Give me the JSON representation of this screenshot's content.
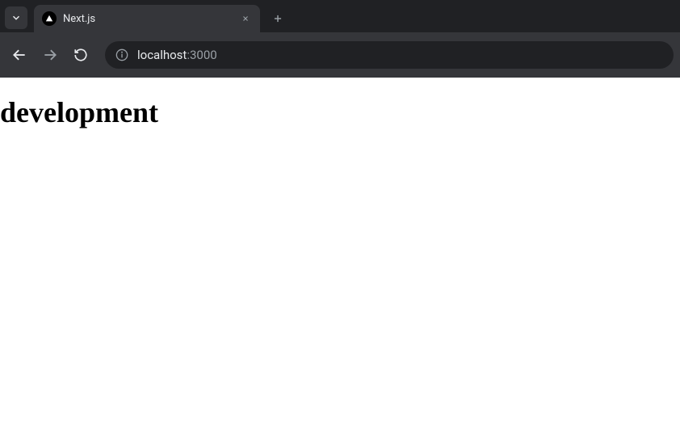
{
  "tab": {
    "title": "Next.js"
  },
  "address": {
    "host": "localhost",
    "port": ":3000"
  },
  "page": {
    "heading": "development"
  }
}
